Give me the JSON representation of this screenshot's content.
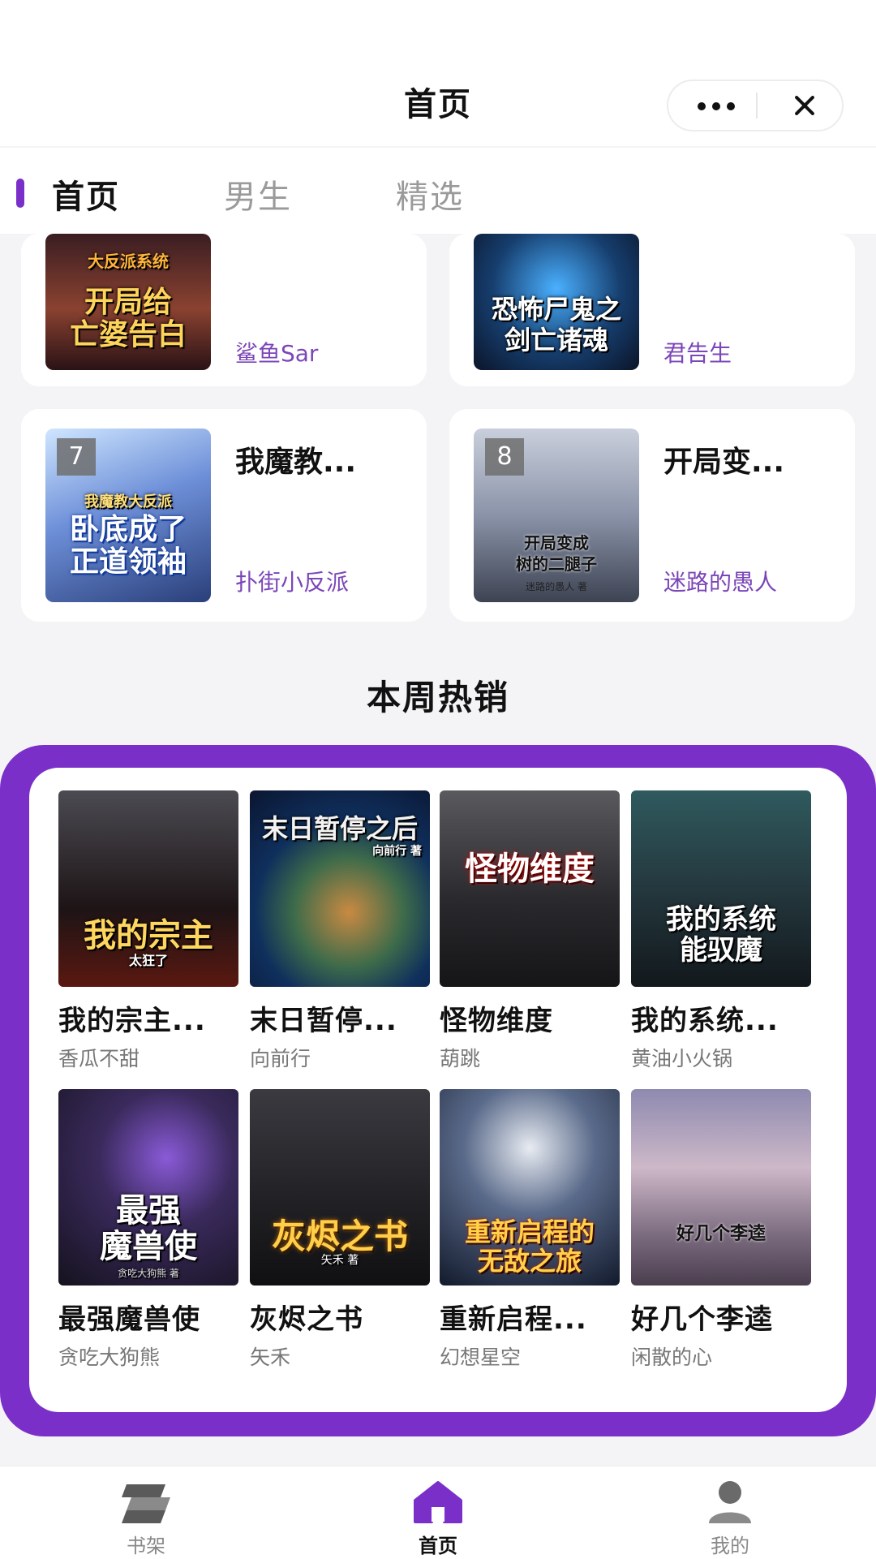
{
  "header": {
    "title": "首页"
  },
  "tabs": [
    {
      "label": "首页",
      "active": true
    },
    {
      "label": "男生",
      "active": false
    },
    {
      "label": "精选",
      "active": false
    }
  ],
  "ranking": [
    {
      "rank": "",
      "title": "",
      "author": "鲨鱼Sar",
      "cover_text": "开局给\n亡婆告白",
      "cover_sub": "大反派系统"
    },
    {
      "rank": "",
      "title": "",
      "author": "君告生",
      "cover_text": "恐怖尸鬼之\n剑亡诸魂",
      "cover_sub": ""
    },
    {
      "rank": "7",
      "title": "我魔教...",
      "author": "扑街小反派",
      "cover_text": "卧底成了\n正道领袖",
      "cover_sub": "我魔教大反派"
    },
    {
      "rank": "8",
      "title": "开局变...",
      "author": "迷路的愚人",
      "cover_text": "开局变成\n树的二腿子",
      "cover_sub": "迷路的愚人 著"
    }
  ],
  "hot": {
    "title": "本周热销",
    "books": [
      {
        "title": "我的宗主...",
        "author": "香瓜不甜",
        "cover_text": "我的宗主",
        "cover_sub": "太狂了"
      },
      {
        "title": "末日暂停...",
        "author": "向前行",
        "cover_text": "末日暂停之后",
        "cover_sub": "向前行 著"
      },
      {
        "title": "怪物维度",
        "author": "葫跳",
        "cover_text": "怪物维度",
        "cover_sub": ""
      },
      {
        "title": "我的系统...",
        "author": "黄油小火锅",
        "cover_text": "我的系统\n能驭魔",
        "cover_sub": ""
      },
      {
        "title": "最强魔兽使",
        "author": "贪吃大狗熊",
        "cover_text": "最强\n魔兽使",
        "cover_sub": "贪吃大狗熊 著"
      },
      {
        "title": "灰烬之书",
        "author": "矢禾",
        "cover_text": "灰烬之书",
        "cover_sub": "矢禾 著"
      },
      {
        "title": "重新启程...",
        "author": "幻想星空",
        "cover_text": "重新启程的\n无敌之旅",
        "cover_sub": ""
      },
      {
        "title": "好几个李逵",
        "author": "闲散的心",
        "cover_text": "好几个李逵",
        "cover_sub": ""
      }
    ]
  },
  "bottom_nav": [
    {
      "label": "书架",
      "icon": "bookshelf-icon"
    },
    {
      "label": "首页",
      "icon": "home-icon",
      "active": true
    },
    {
      "label": "我的",
      "icon": "user-icon"
    }
  ],
  "colors": {
    "accent": "#7b2fc9",
    "author": "#7b46b8"
  }
}
